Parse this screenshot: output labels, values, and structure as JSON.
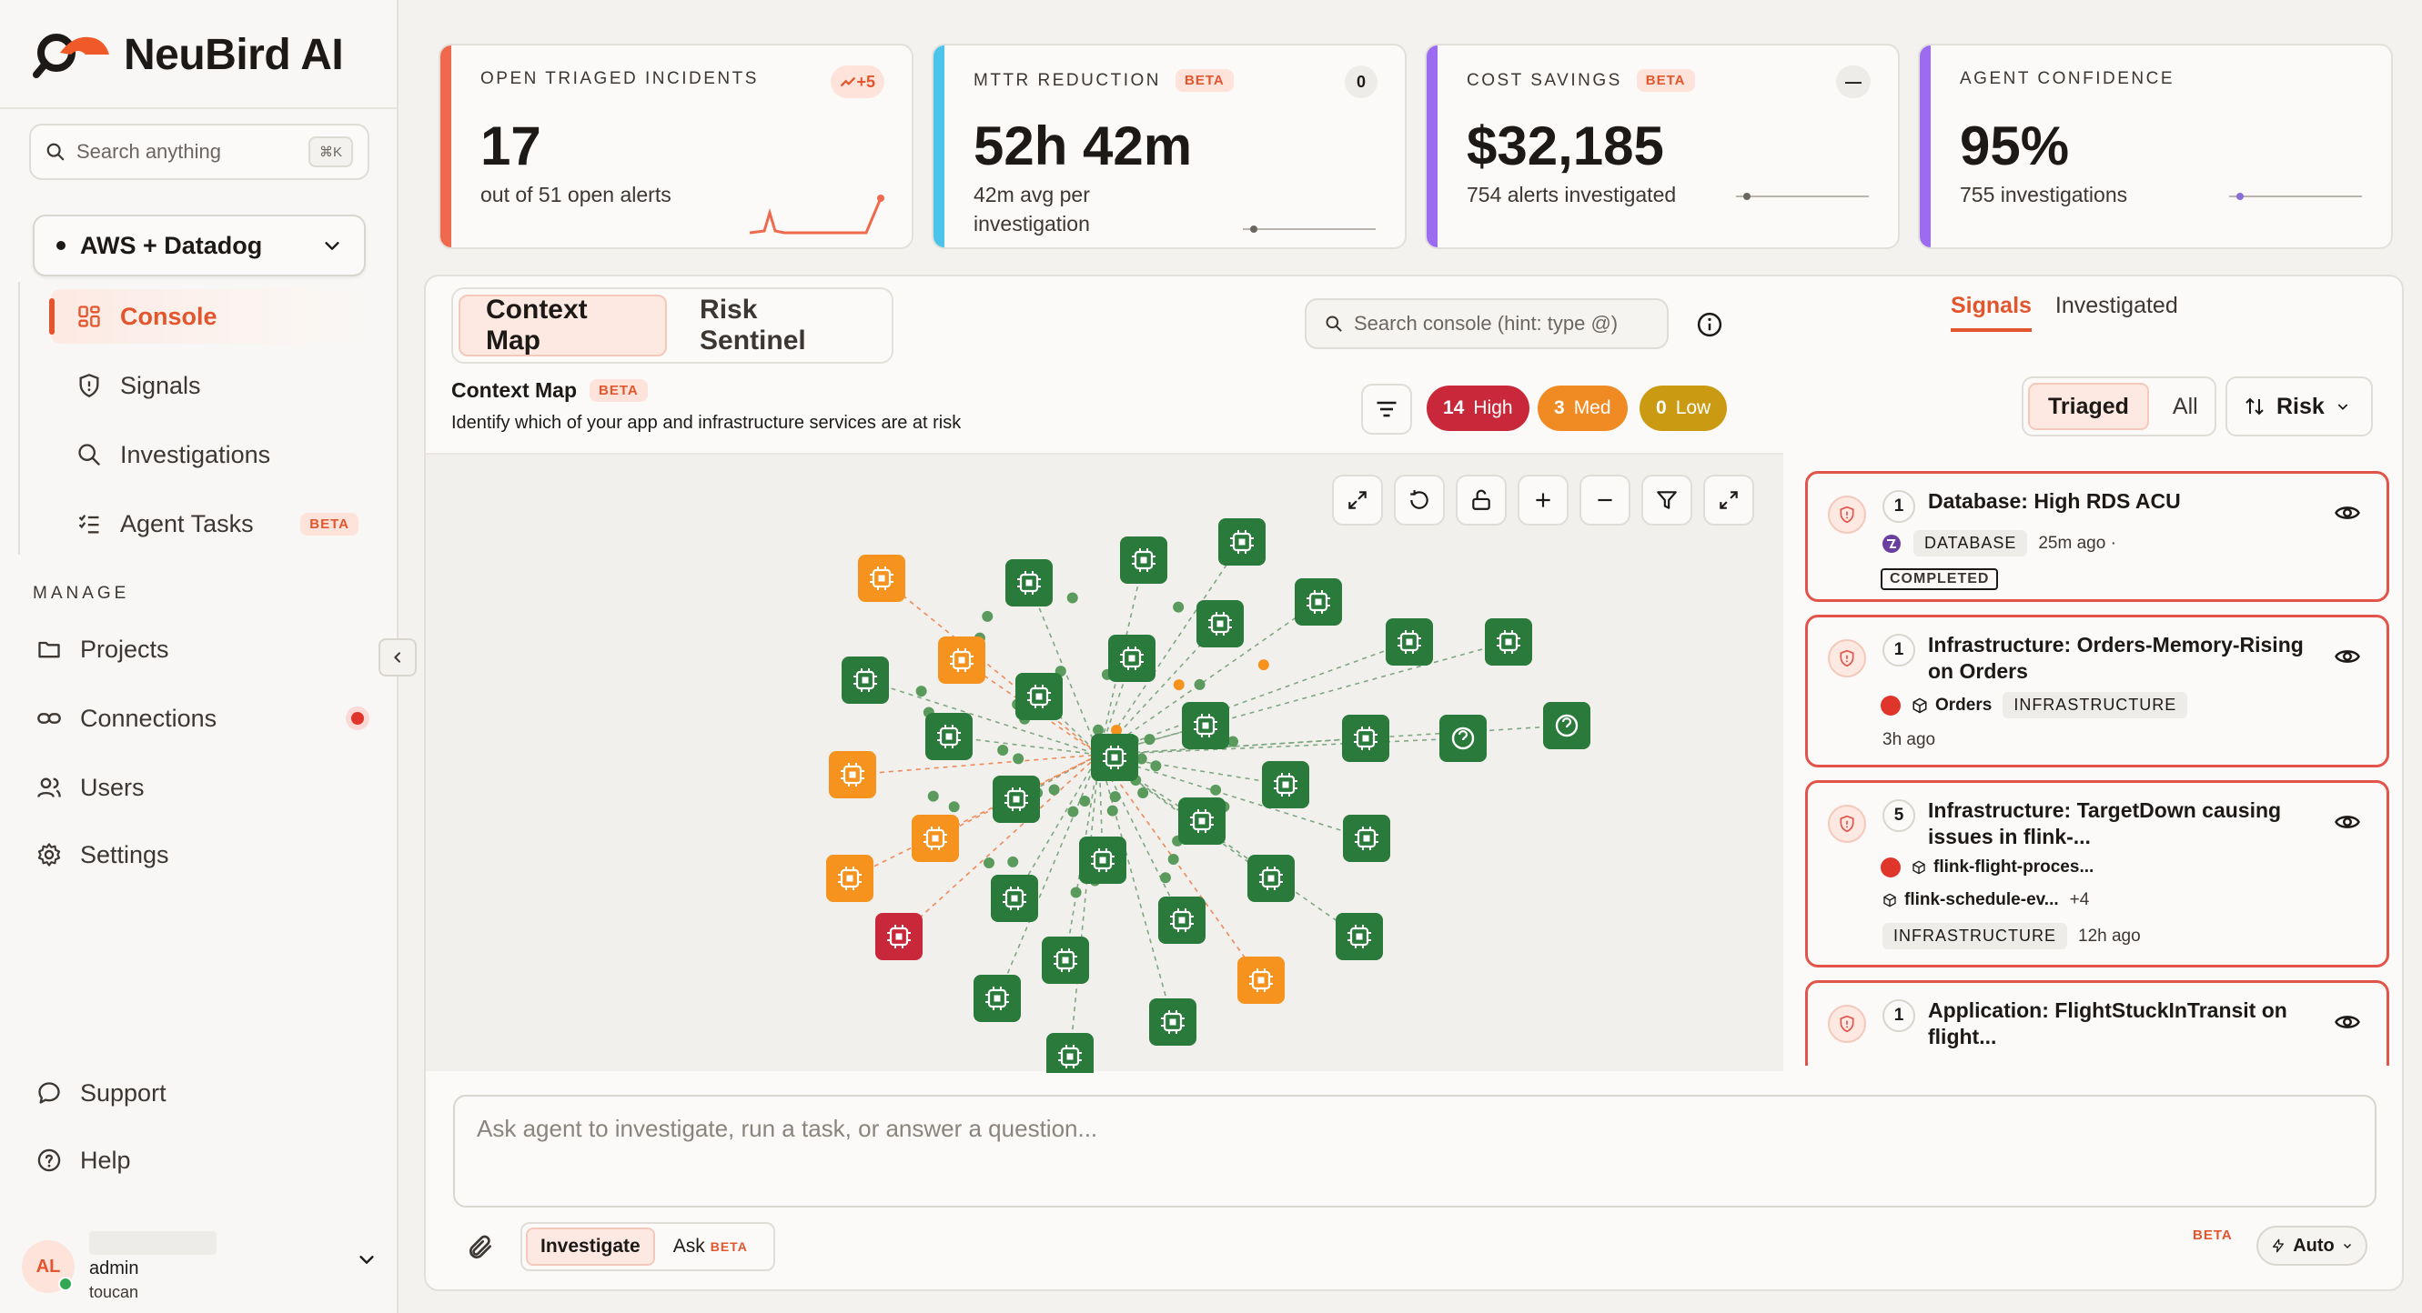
{
  "app": {
    "brand": "NeuBird AI"
  },
  "sidebar": {
    "search_placeholder": "Search anything",
    "search_shortcut": "⌘K",
    "environment": "AWS + Datadog",
    "nav": [
      {
        "label": "Console",
        "icon": "grid-icon",
        "active": true
      },
      {
        "label": "Signals",
        "icon": "shield-icon"
      },
      {
        "label": "Investigations",
        "icon": "search-icon"
      },
      {
        "label": "Agent Tasks",
        "icon": "list-check-icon",
        "badge": "BETA"
      }
    ],
    "manage_label": "MANAGE",
    "manage": [
      {
        "label": "Projects",
        "icon": "folder-icon"
      },
      {
        "label": "Connections",
        "icon": "link-icon",
        "alert": true
      },
      {
        "label": "Users",
        "icon": "users-icon"
      },
      {
        "label": "Settings",
        "icon": "gear-icon"
      }
    ],
    "footer": [
      {
        "label": "Support",
        "icon": "chat-bubble-icon"
      },
      {
        "label": "Help",
        "icon": "help-circle-icon"
      }
    ],
    "user": {
      "initials": "AL",
      "name": "admin",
      "org": "toucan"
    }
  },
  "kpis": [
    {
      "label": "OPEN TRIAGED INCIDENTS",
      "chip": "+5",
      "value": "17",
      "sub": "out of 51 open alerts",
      "color": "#ef6a4c"
    },
    {
      "label": "MTTR REDUCTION",
      "badge": "BETA",
      "chip": "0",
      "value": "52h 42m",
      "sub": "42m avg per investigation",
      "color": "#4cc3e8"
    },
    {
      "label": "COST SAVINGS",
      "badge": "BETA",
      "chip": "—",
      "value": "$32,185",
      "sub": "754 alerts investigated",
      "color": "#9b6cf0"
    },
    {
      "label": "AGENT CONFIDENCE",
      "value": "95%",
      "sub": "755 investigations",
      "color": "#9b6cf0"
    }
  ],
  "console": {
    "tabs": [
      "Context Map",
      "Risk Sentinel"
    ],
    "active_tab": "Context Map",
    "title": "Context Map",
    "title_badge": "BETA",
    "description": "Identify which of your app and infrastructure services are at risk",
    "search_placeholder": "Search console (hint: type @)",
    "severity": [
      {
        "count": "14",
        "label": "High",
        "color": "#c8283a"
      },
      {
        "count": "3",
        "label": "Med",
        "color": "#f08a22"
      },
      {
        "count": "0",
        "label": "Low",
        "color": "#c99a12"
      }
    ],
    "graph_colors": {
      "healthy": "#2a7a3b",
      "warning": "#f6921e",
      "critical": "#c8283a",
      "dot": "#5a9a5c"
    }
  },
  "signals_panel": {
    "tabs": [
      "Signals",
      "Investigated"
    ],
    "active_tab": "Signals",
    "filters": [
      "Triaged",
      "All"
    ],
    "active_filter": "Triaged",
    "sort_label": "Risk",
    "cards": [
      {
        "count": "1",
        "title": "Database: High RDS ACU",
        "tag": "DATABASE",
        "time": "25m ago ·",
        "status": "COMPLETED"
      },
      {
        "count": "1",
        "title": "Infrastructure: Orders-Memory-Rising on Orders",
        "service": "Orders",
        "tag": "INFRASTRUCTURE",
        "time": "3h ago"
      },
      {
        "count": "5",
        "title": "Infrastructure: TargetDown causing issues in flink-...",
        "service": "flink-flight-proces...",
        "service2": "flink-schedule-ev...",
        "more": "+4",
        "tag": "INFRASTRUCTURE",
        "time": "12h ago"
      },
      {
        "count": "1",
        "title": "Application: FlightStuckInTransit on flight..."
      }
    ]
  },
  "chat": {
    "placeholder": "Ask agent to investigate, run a task, or answer a question...",
    "modes": [
      "Investigate",
      "Ask"
    ],
    "active_mode": "Investigate",
    "ask_badge": "BETA",
    "beta_label": "BETA",
    "model_label": "Auto"
  }
}
